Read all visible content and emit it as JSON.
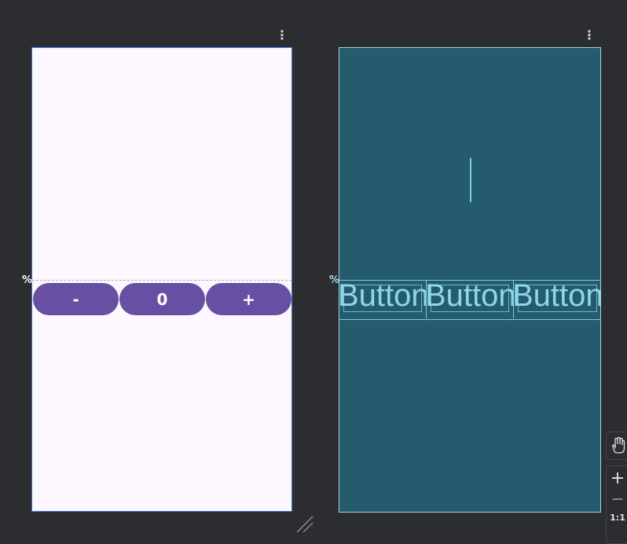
{
  "design_menu": "⋮",
  "blueprint_menu": "⋮",
  "guideline_marker": "%",
  "buttons": {
    "decrement": "-",
    "count": "0",
    "increment": "+"
  },
  "blueprint": {
    "button_labels": [
      "Button",
      "Button",
      "Button"
    ]
  },
  "toolbar": {
    "zoom_in": "+",
    "zoom_out": "—",
    "zoom_ratio": "1:1"
  },
  "colors": {
    "button_fill": "#6750a4",
    "design_background": "#fdf7ff",
    "blueprint_background": "#245c6d",
    "blueprint_lines": "#7fd0e4"
  }
}
